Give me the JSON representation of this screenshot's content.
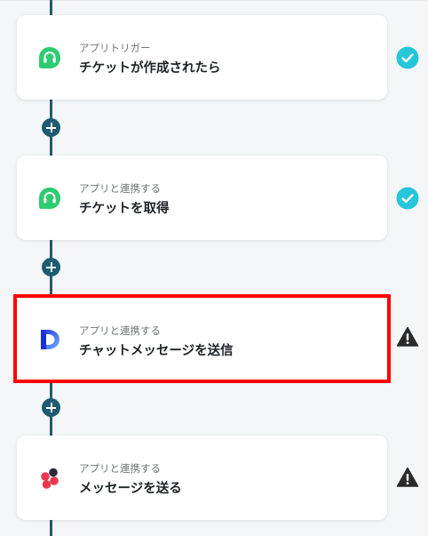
{
  "flow": {
    "steps": [
      {
        "subtitle": "アプリトリガー",
        "title": "チケットが作成されたら",
        "app_icon": "headset-icon",
        "status": "complete"
      },
      {
        "subtitle": "アプリと連携する",
        "title": "チケットを取得",
        "app_icon": "headset-icon",
        "status": "complete"
      },
      {
        "subtitle": "アプリと連携する",
        "title": "チャットメッセージを送信",
        "app_icon": "dialpad-logo-icon",
        "status": "warning"
      },
      {
        "subtitle": "アプリと連携する",
        "title": "メッセージを送る",
        "app_icon": "slack-like-logo-icon",
        "status": "warning"
      }
    ]
  },
  "colors": {
    "rail": "#1d5c72",
    "complete": "#26c6da",
    "warning": "#2b2b2b",
    "highlight": "#ff0000",
    "headset_icon": "#2ecc71"
  }
}
